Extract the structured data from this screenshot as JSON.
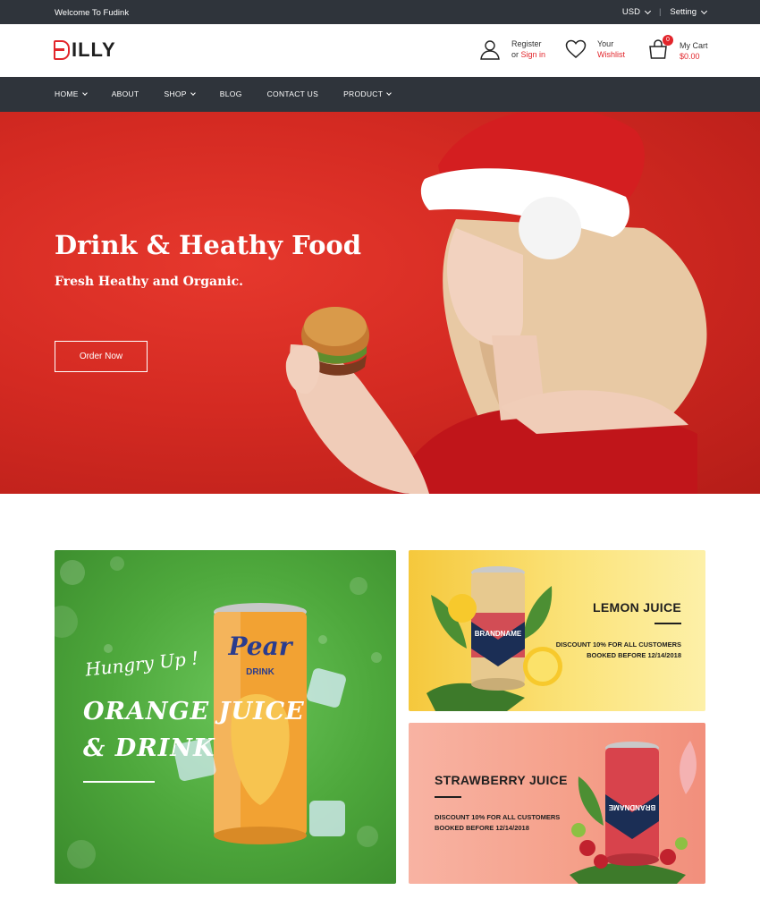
{
  "topbar": {
    "welcome": "Welcome To Fudink",
    "currency": "USD",
    "setting": "Setting"
  },
  "header": {
    "logo_letter": "B",
    "logo_text": "ILLY",
    "register": {
      "line1": "Register",
      "line2_prefix": "or ",
      "line2_link": "Sign in"
    },
    "wishlist": {
      "line1": "Your",
      "line2": "Wishlist"
    },
    "cart": {
      "line1": "My Cart",
      "amount": "$0.00",
      "count": "0"
    }
  },
  "nav": {
    "items": [
      {
        "label": "HOME",
        "dropdown": true
      },
      {
        "label": "ABOUT",
        "dropdown": false
      },
      {
        "label": "SHOP",
        "dropdown": true
      },
      {
        "label": "BLOG",
        "dropdown": false
      },
      {
        "label": "CONTACT US",
        "dropdown": false
      },
      {
        "label": "PRODUCT",
        "dropdown": true
      }
    ]
  },
  "hero": {
    "title": "Drink & Heathy Food",
    "subtitle": "Fresh Heathy and Organic.",
    "button": "Order Now"
  },
  "banners": {
    "orange": {
      "script": "Hungry Up !",
      "title_line1": "ORANGE JUICE",
      "title_line2": "& DRINK",
      "can_brand": "Pear",
      "can_sub": "DRINK"
    },
    "lemon": {
      "title": "LEMON JUICE",
      "disc_line1": "DISCOUNT 10% FOR ALL CUSTOMERS",
      "disc_line2": "BOOKED BEFORE 12/14/2018",
      "can_brand": "BRANDNAME"
    },
    "strawberry": {
      "title": "STRAWBERRY JUICE",
      "disc_line1": "DISCOUNT 10% FOR ALL CUSTOMERS",
      "disc_line2": "BOOKED BEFORE 12/14/2018",
      "can_brand": "BRANDNAME"
    }
  },
  "colors": {
    "accent": "#e2252b",
    "dark_bar": "#2f343b",
    "hero_red": "#d42a22"
  }
}
